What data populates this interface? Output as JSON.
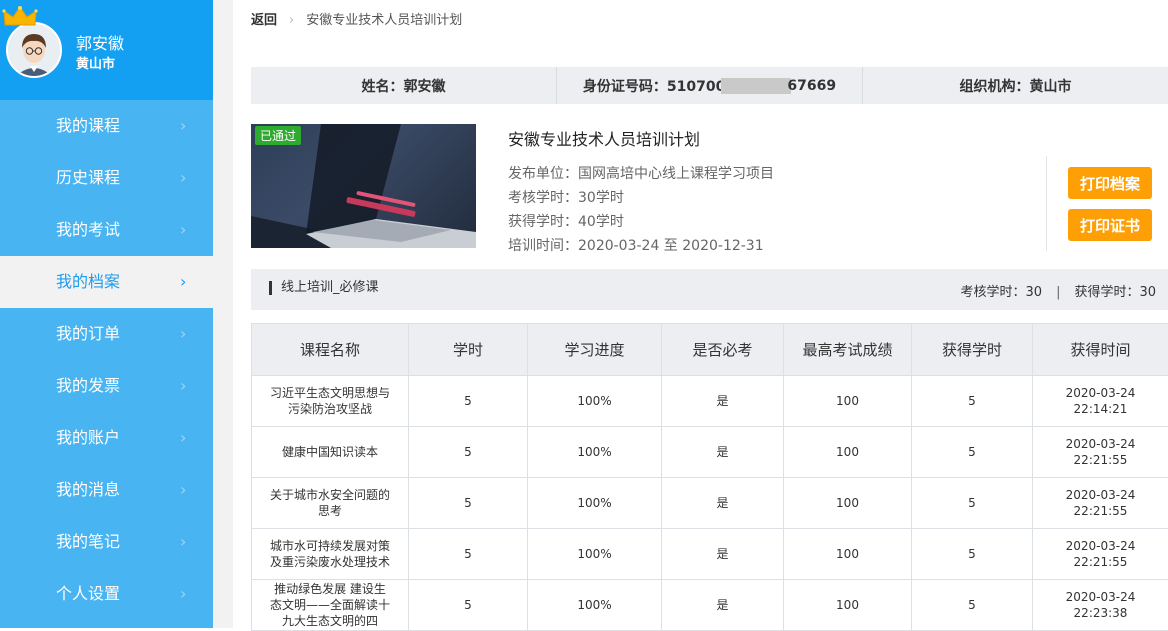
{
  "user": {
    "name": "郭安徽",
    "city": "黄山市"
  },
  "sidebar": {
    "items": [
      {
        "label": "我的课程"
      },
      {
        "label": "历史课程"
      },
      {
        "label": "我的考试"
      },
      {
        "label": "我的档案"
      },
      {
        "label": "我的订单"
      },
      {
        "label": "我的发票"
      },
      {
        "label": "我的账户"
      },
      {
        "label": "我的消息"
      },
      {
        "label": "我的笔记"
      },
      {
        "label": "个人设置"
      }
    ],
    "active_index": 3
  },
  "breadcrumb": {
    "back": "返回",
    "current": "安徽专业技术人员培训计划"
  },
  "info": {
    "name": "姓名：郭安徽",
    "id_prefix": "身份证号码：510700",
    "id_suffix": "67669",
    "org": "组织机构：黄山市"
  },
  "plan": {
    "badge": "已通过",
    "title": "安徽专业技术人员培训计划",
    "publisher": "发布单位：国网高培中心线上课程学习项目",
    "required_hours": "考核学时：30学时",
    "earned_hours": "获得学时：40学时",
    "period": "培训时间：2020-03-24 至 2020-12-31",
    "print_archive": "打印档案",
    "print_certificate": "打印证书"
  },
  "section": {
    "title": "线上培训_必修课",
    "required": "考核学时：30",
    "earned": "获得学时：30",
    "divider": "|"
  },
  "table": {
    "headers": [
      "课程名称",
      "学时",
      "学习进度",
      "是否必考",
      "最高考试成绩",
      "获得学时",
      "获得时间"
    ],
    "rows": [
      {
        "name": "习近平生态文明思想与污染防治攻坚战",
        "hours": "5",
        "progress": "100%",
        "required": "是",
        "score": "100",
        "earned": "5",
        "date": "2020-03-24",
        "time": "22:14:21"
      },
      {
        "name": "健康中国知识读本",
        "hours": "5",
        "progress": "100%",
        "required": "是",
        "score": "100",
        "earned": "5",
        "date": "2020-03-24",
        "time": "22:21:55"
      },
      {
        "name": "关于城市水安全问题的思考",
        "hours": "5",
        "progress": "100%",
        "required": "是",
        "score": "100",
        "earned": "5",
        "date": "2020-03-24",
        "time": "22:21:55"
      },
      {
        "name": "城市水可持续发展对策及重污染废水处理技术",
        "hours": "5",
        "progress": "100%",
        "required": "是",
        "score": "100",
        "earned": "5",
        "date": "2020-03-24",
        "time": "22:21:55"
      },
      {
        "name": "推动绿色发展 建设生态文明——全面解读十九大生态文明的四",
        "hours": "5",
        "progress": "100%",
        "required": "是",
        "score": "100",
        "earned": "5",
        "date": "2020-03-24",
        "time": "22:23:38"
      }
    ]
  }
}
